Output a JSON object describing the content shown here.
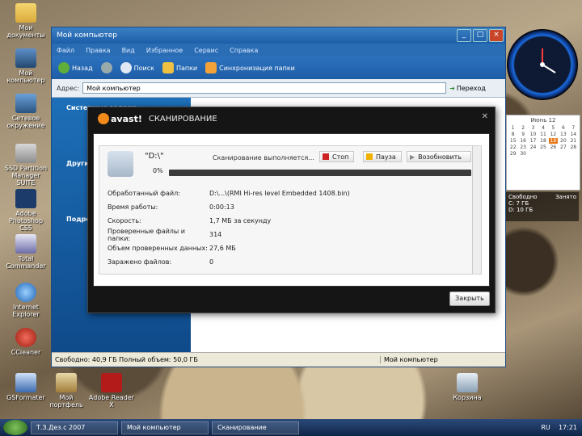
{
  "desktop": {
    "icons_left": [
      {
        "label": "Мои документы"
      },
      {
        "label": "Мой компьютер"
      },
      {
        "label": "Сетевое окружение"
      },
      {
        "label": "SSD Partition Manager SUITE"
      },
      {
        "label": "Adobe Photoshop CS5"
      },
      {
        "label": "Total Commander"
      },
      {
        "label": "Internet Explorer"
      },
      {
        "label": "CCleaner"
      },
      {
        "label": "GSFormater"
      }
    ],
    "icons_bottom": [
      {
        "label": "Мой портфель"
      },
      {
        "label": "Adobe Reader X"
      },
      {
        "label": "Корзина"
      }
    ]
  },
  "explorer": {
    "title": "Мой компьютер",
    "menu": [
      "Файл",
      "Правка",
      "Вид",
      "Избранное",
      "Сервис",
      "Справка"
    ],
    "toolbar": {
      "back": "Назад",
      "search": "Поиск",
      "folders": "Папки",
      "sync": "Синхронизация папки"
    },
    "address_label": "Адрес:",
    "address_value": "Мой компьютер",
    "go_label": "Переход",
    "left_pane": {
      "system_tasks_header": "Системные задачи",
      "other_places_header": "Другие места",
      "details_header": "Подробно"
    },
    "status_left": "Свободно: 40,9 ГБ  Полный объем: 50,0 ГБ",
    "status_right": "Мой компьютер"
  },
  "avast": {
    "logo": "avast!",
    "title": "СКАНИРОВАНИЕ",
    "scan_path": "\"D:\\\"",
    "progress_text": "0%",
    "progress_fraction": 0.0,
    "status_text": "Сканирование выполняется...",
    "buttons": {
      "stop": "Стоп",
      "pause": "Пауза",
      "resume": "Возобновить"
    },
    "stats": [
      {
        "key": "Обработанный файл:",
        "value": "D:\\...\\(RMI Hi-res level Embedded 1408.bin)"
      },
      {
        "key": "Время работы:",
        "value": "0:00:13"
      },
      {
        "key": "Скорость:",
        "value": "1,7 МБ за секунду"
      },
      {
        "key": "Проверенные файлы и папки:",
        "value": "314"
      },
      {
        "key": "Объем проверенных данных:",
        "value": "27,6 МБ"
      },
      {
        "key": "Заражено файлов:",
        "value": "0"
      }
    ],
    "close_label": "Закрыть",
    "colors": {
      "accent": "#f08a1a",
      "progress": "#7ab33e",
      "stop": "#cc2222",
      "pause": "#f0b000"
    }
  },
  "gadgets": {
    "calendar_month": "Июнь 12",
    "calendar_days": [
      "1",
      "2",
      "3",
      "4",
      "5",
      "6",
      "7",
      "8",
      "9",
      "10",
      "11",
      "12",
      "13",
      "14",
      "15",
      "16",
      "17",
      "18",
      "19",
      "20",
      "21",
      "22",
      "23",
      "24",
      "25",
      "26",
      "27",
      "28",
      "29",
      "30"
    ],
    "today": "19",
    "meter": {
      "free_label": "Свободно",
      "used_label": "Занято",
      "c_drive": "C: 7 ГБ",
      "d_drive": "D: 10 ГБ"
    }
  },
  "taskbar": {
    "tasks": [
      "Т.З.Дез.с 2007",
      "Мой компьютер",
      "Сканирование"
    ],
    "lang": "RU",
    "time": "17:21"
  }
}
